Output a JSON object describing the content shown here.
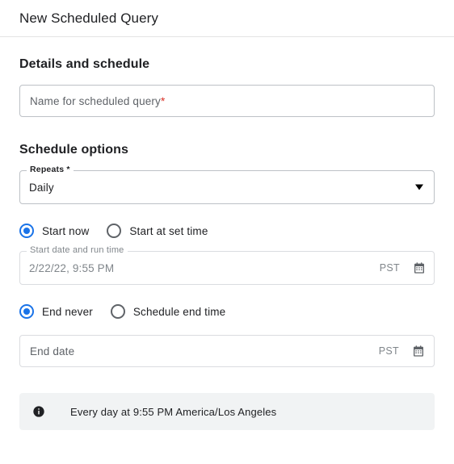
{
  "header": {
    "title": "New Scheduled Query"
  },
  "details_section": {
    "heading": "Details and schedule",
    "name_field": {
      "placeholder": "Name for scheduled query",
      "required_marker": "*",
      "value": ""
    }
  },
  "schedule_section": {
    "heading": "Schedule options",
    "repeats": {
      "label": "Repeats *",
      "selected": "Daily",
      "options": [
        "Daily"
      ],
      "arrow_icon": "chevron-down-icon"
    },
    "start_radio_group": {
      "options": [
        {
          "label": "Start now",
          "checked": true
        },
        {
          "label": "Start at set time",
          "checked": false
        }
      ]
    },
    "start_date_field": {
      "label": "Start date and run time",
      "value": "2/22/22, 9:55 PM",
      "timezone": "PST",
      "calendar_icon": "calendar-icon",
      "disabled": true
    },
    "end_radio_group": {
      "options": [
        {
          "label": "End never",
          "checked": true
        },
        {
          "label": "Schedule end time",
          "checked": false
        }
      ]
    },
    "end_date_field": {
      "placeholder": "End date",
      "value": "",
      "timezone": "PST",
      "calendar_icon": "calendar-icon",
      "disabled": true
    }
  },
  "info_banner": {
    "icon": "info-icon",
    "text": "Every day at 9:55 PM America/Los Angeles"
  },
  "colors": {
    "accent": "#1a73e8",
    "required": "#d93025",
    "text_primary": "#202124",
    "text_secondary": "#5f6368",
    "text_disabled": "#80868b",
    "banner_bg": "#f1f3f4",
    "border": "#bdc1c6"
  }
}
